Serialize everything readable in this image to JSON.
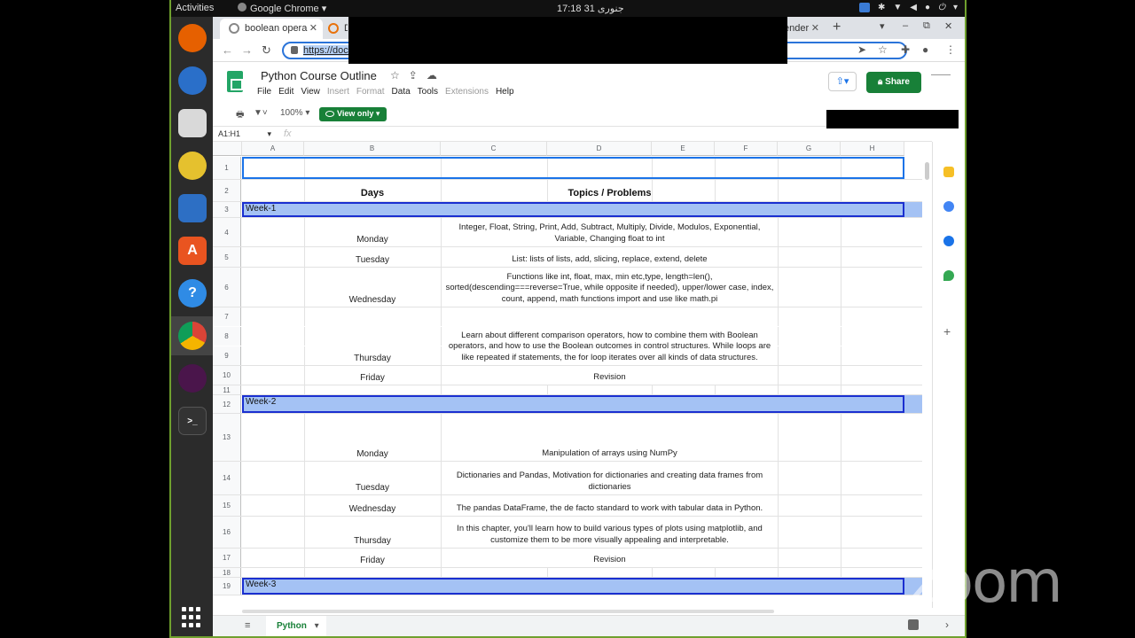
{
  "os": {
    "activities": "Activities",
    "app_name": "Google Chrome",
    "app_menu_arrow": "▾",
    "clock": "17:18  جنوری 31",
    "tray_icons": [
      "zoom-icon",
      "settings-icon",
      "wifi-icon",
      "volume-icon",
      "mic-icon",
      "power-icon"
    ]
  },
  "dock": {
    "apps": [
      "firefox",
      "thunderbird",
      "files",
      "rhythmbox",
      "writer",
      "software",
      "help",
      "chrome",
      "slack",
      "terminal"
    ]
  },
  "browser": {
    "tabs": [
      {
        "title": "boolean opera",
        "close": "✕"
      },
      {
        "title": "D",
        "close": ""
      },
      {
        "title": "ender",
        "close": "✕"
      }
    ],
    "new_tab": "+",
    "url": "https://docs",
    "window_controls": [
      "▾",
      "–",
      "⧉",
      "✕"
    ]
  },
  "sheet": {
    "title": "Python Course Outline",
    "menu": [
      {
        "label": "File",
        "enabled": true
      },
      {
        "label": "Edit",
        "enabled": true
      },
      {
        "label": "View",
        "enabled": true
      },
      {
        "label": "Insert",
        "enabled": false
      },
      {
        "label": "Format",
        "enabled": false
      },
      {
        "label": "Data",
        "enabled": true
      },
      {
        "label": "Tools",
        "enabled": true
      },
      {
        "label": "Extensions",
        "enabled": false
      },
      {
        "label": "Help",
        "enabled": true
      }
    ],
    "share_label": "Share",
    "zoom": "100%",
    "view_only_label": "View only",
    "name_box": "A1:H1",
    "fx_label": "fx",
    "columns": [
      "A",
      "B",
      "C",
      "D",
      "E",
      "F",
      "G",
      "H"
    ],
    "header": {
      "days": "Days",
      "topics": "Topics / Problems"
    },
    "rows": [
      {
        "n": "1",
        "kind": "blank-selected"
      },
      {
        "n": "2",
        "kind": "header"
      },
      {
        "n": "3",
        "kind": "week",
        "label": "Week-1"
      },
      {
        "n": "4",
        "kind": "data",
        "day": "Monday",
        "topic": "Integer, Float, String, Print, Add, Subtract, Multiply, Divide, Modulos, Exponential, Variable, Changing float to int"
      },
      {
        "n": "5",
        "kind": "data",
        "day": "Tuesday",
        "topic": "List: lists of lists, add, slicing, replace, extend, delete"
      },
      {
        "n": "6",
        "kind": "data",
        "day": "Wednesday",
        "topic": "Functions like int, float, max, min etc,type, length=len(), sorted(descending===reverse=True, while opposite if needed), upper/lower case, index, count,  append, math functions import and use like math.pi"
      },
      {
        "n": "7",
        "kind": "merged"
      },
      {
        "n": "8",
        "kind": "merged"
      },
      {
        "n": "9",
        "kind": "data",
        "day": "Thursday",
        "topic": "Learn about different comparison operators, how to combine them with Boolean operators, and how to use the Boolean outcomes in control structures. While loops are like repeated if statements, the for loop iterates over all kinds of data structures."
      },
      {
        "n": "10",
        "kind": "data",
        "day": "Friday",
        "topic": "Revision"
      },
      {
        "n": "11",
        "kind": "blank"
      },
      {
        "n": "12",
        "kind": "week",
        "label": "Week-2"
      },
      {
        "n": "13",
        "kind": "data",
        "day": "Monday",
        "topic": "Manipulation of arrays using NumPy"
      },
      {
        "n": "14",
        "kind": "data",
        "day": "Tuesday",
        "topic": "Dictionaries and Pandas, Motivation for dictionaries and creating data frames from dictionaries"
      },
      {
        "n": "15",
        "kind": "data",
        "day": "Wednesday",
        "topic": "The pandas DataFrame, the de facto standard to work with tabular data in Python."
      },
      {
        "n": "16",
        "kind": "data",
        "day": "Thursday",
        "topic": "In this chapter, you'll learn how to build various types of plots using matplotlib, and customize them to be more visually appealing and interpretable."
      },
      {
        "n": "17",
        "kind": "data",
        "day": "Friday",
        "topic": "Revision"
      },
      {
        "n": "18",
        "kind": "blank"
      },
      {
        "n": "19",
        "kind": "week",
        "label": "Week-3"
      }
    ],
    "sheet_tab": "Python",
    "sheet_tab_arrow": "▾"
  },
  "overlay": {
    "watermark": "zoom"
  },
  "colors": {
    "accent": "#1a73e8",
    "share": "#188038",
    "week_band": "#a4c2f4",
    "week_border": "#1a2fd0"
  }
}
